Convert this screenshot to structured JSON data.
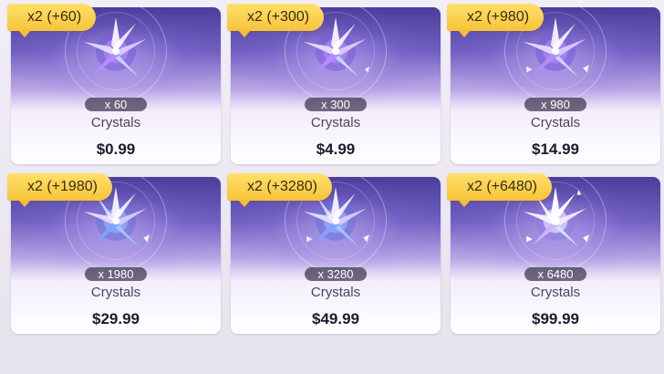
{
  "shop": {
    "packs": [
      {
        "bonus": "x2 (+60)",
        "quantity": "x 60",
        "name": "Crystals",
        "price": "$0.99",
        "gem_color": "#b58cff"
      },
      {
        "bonus": "x2 (+300)",
        "quantity": "x 300",
        "name": "Crystals",
        "price": "$4.99",
        "gem_color": "#b58cff"
      },
      {
        "bonus": "x2 (+980)",
        "quantity": "x 980",
        "name": "Crystals",
        "price": "$14.99",
        "gem_color": "#b58cff"
      },
      {
        "bonus": "x2 (+1980)",
        "quantity": "x 1980",
        "name": "Crystals",
        "price": "$29.99",
        "gem_color": "#9fb6ff"
      },
      {
        "bonus": "x2 (+3280)",
        "quantity": "x 3280",
        "name": "Crystals",
        "price": "$49.99",
        "gem_color": "#9fb6ff"
      },
      {
        "bonus": "x2 (+6480)",
        "quantity": "x 6480",
        "name": "Crystals",
        "price": "$99.99",
        "gem_color": "#e6ddff"
      }
    ],
    "colors": {
      "bonus_tag": "#f6c43a",
      "card_top": "#4a3e9c",
      "price_text": "#1e1b2a"
    }
  }
}
